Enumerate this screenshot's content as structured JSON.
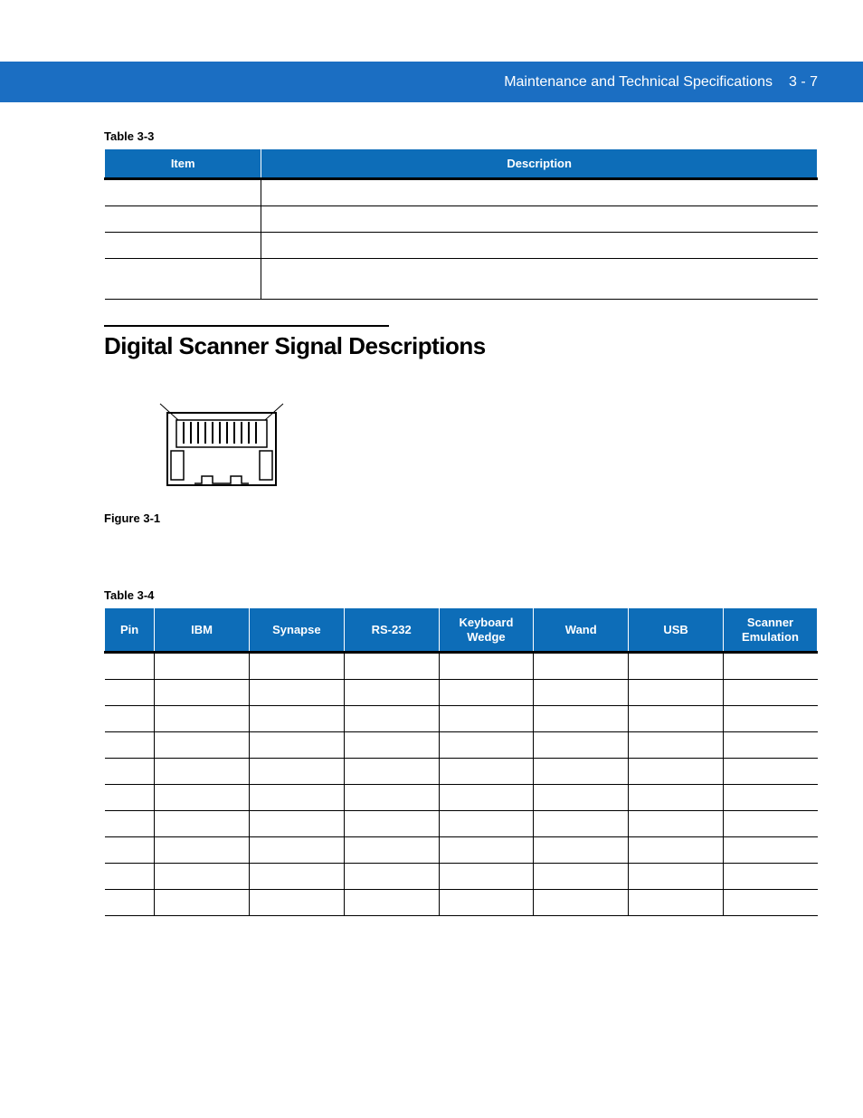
{
  "header": {
    "title": "Maintenance and Technical Specifications",
    "page": "3 - 7"
  },
  "table33": {
    "label": "Table 3-3",
    "cols": [
      "Item",
      "Description"
    ],
    "rows": 4
  },
  "section": {
    "heading": "Digital Scanner Signal Descriptions"
  },
  "figure31": {
    "label": "Figure 3-1"
  },
  "table34": {
    "label": "Table 3-4",
    "cols": [
      "Pin",
      "IBM",
      "Synapse",
      "RS-232",
      "Keyboard\nWedge",
      "Wand",
      "USB",
      "Scanner\nEmulation"
    ],
    "rows": 10
  }
}
